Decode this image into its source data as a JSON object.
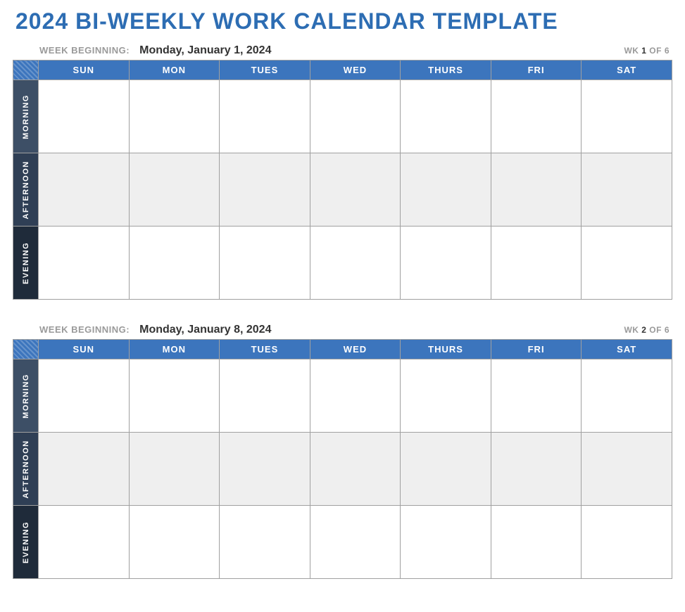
{
  "title": "2024 BI-WEEKLY WORK CALENDAR TEMPLATE",
  "week_beginning_label": "WEEK BEGINNING:",
  "wk_prefix": "WK ",
  "wk_of": " OF ",
  "total_weeks": "6",
  "days": [
    "SUN",
    "MON",
    "TUES",
    "WED",
    "THURS",
    "FRI",
    "SAT"
  ],
  "periods": {
    "morning": "MORNING",
    "afternoon": "AFTERNOON",
    "evening": "EVENING"
  },
  "weeks": [
    {
      "date": "Monday, January 1, 2024",
      "number": "1"
    },
    {
      "date": "Monday, January 8, 2024",
      "number": "2"
    }
  ]
}
